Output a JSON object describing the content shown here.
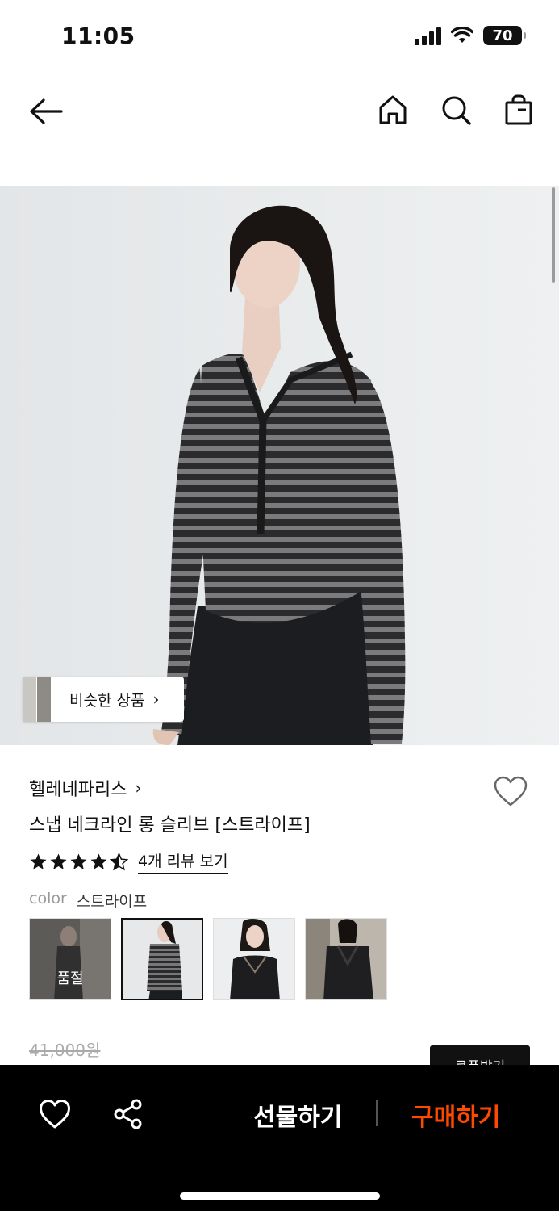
{
  "status": {
    "time": "11:05",
    "battery": "70"
  },
  "nav": {
    "back_icon": "arrow-left-icon",
    "home_icon": "home-icon",
    "search_icon": "search-icon",
    "bag_icon": "shopping-bag-icon"
  },
  "hero": {
    "similar_label": "비슷한 상품"
  },
  "product": {
    "brand": "헬레네파리스",
    "name": "스냅 네크라인 롱 슬리브 [스트라이프]",
    "rating": 4.5,
    "review_link": "4개 리뷰 보기",
    "color_key": "color",
    "color_value": "스트라이프",
    "swatches": [
      {
        "label": "품절",
        "sold_out": true
      },
      {
        "label": "",
        "selected": true
      },
      {
        "label": ""
      },
      {
        "label": ""
      }
    ],
    "original_price": "41,000원",
    "coupon_label": "쿠폰받기"
  },
  "bottom_bar": {
    "gift_label": "선물하기",
    "buy_label": "구매하기",
    "buy_color": "#ff4800"
  },
  "colors": {
    "accent": "#ff4800",
    "background": "#ffffff",
    "bar": "#000000"
  }
}
